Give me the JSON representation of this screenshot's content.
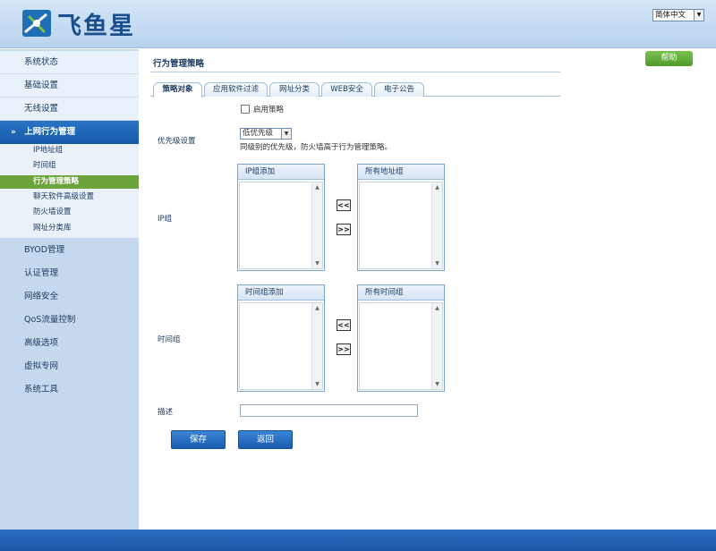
{
  "header": {
    "logo_text": "飞鱼星",
    "language": "简体中文"
  },
  "sidebar": {
    "items_top": [
      {
        "label": "系统状态"
      },
      {
        "label": "基础设置"
      },
      {
        "label": "无线设置"
      }
    ],
    "active_group": "上网行为管理",
    "sub_items": [
      {
        "label": "IP地址组"
      },
      {
        "label": "时间组"
      },
      {
        "label": "行为管理策略",
        "active": true
      },
      {
        "label": "聊天软件高级设置"
      },
      {
        "label": "防火墙设置"
      },
      {
        "label": "网址分类库"
      }
    ],
    "items_bottom": [
      {
        "label": "BYOD管理"
      },
      {
        "label": "认证管理"
      },
      {
        "label": "网络安全"
      },
      {
        "label": "QoS流量控制"
      },
      {
        "label": "高级选项"
      },
      {
        "label": "虚拟专网"
      },
      {
        "label": "系统工具"
      }
    ]
  },
  "main": {
    "page_title": "行为管理策略",
    "help_label": "帮助",
    "tabs": [
      {
        "label": "策略对象",
        "active": true
      },
      {
        "label": "应用软件过滤"
      },
      {
        "label": "网址分类"
      },
      {
        "label": "WEB安全"
      },
      {
        "label": "电子公告"
      }
    ],
    "enable_label": "启用策略",
    "priority_label": "优先级设置",
    "priority_value": "低优先级",
    "priority_hint": "同级别的优先级，防火墙高于行为管理策略。",
    "ip_group_label": "IP组",
    "ip_added_header": "IP组添加",
    "ip_all_header": "所有地址组",
    "time_group_label": "时间组",
    "time_added_header": "时间组添加",
    "time_all_header": "所有时间组",
    "move_left": "<<",
    "move_right": ">>",
    "desc_label": "描述",
    "desc_value": "",
    "save_label": "保存",
    "back_label": "返回"
  },
  "colors": {
    "accent": "#1b5cb0",
    "active_sub": "#6ca33a",
    "help": "#4e9a2b"
  }
}
